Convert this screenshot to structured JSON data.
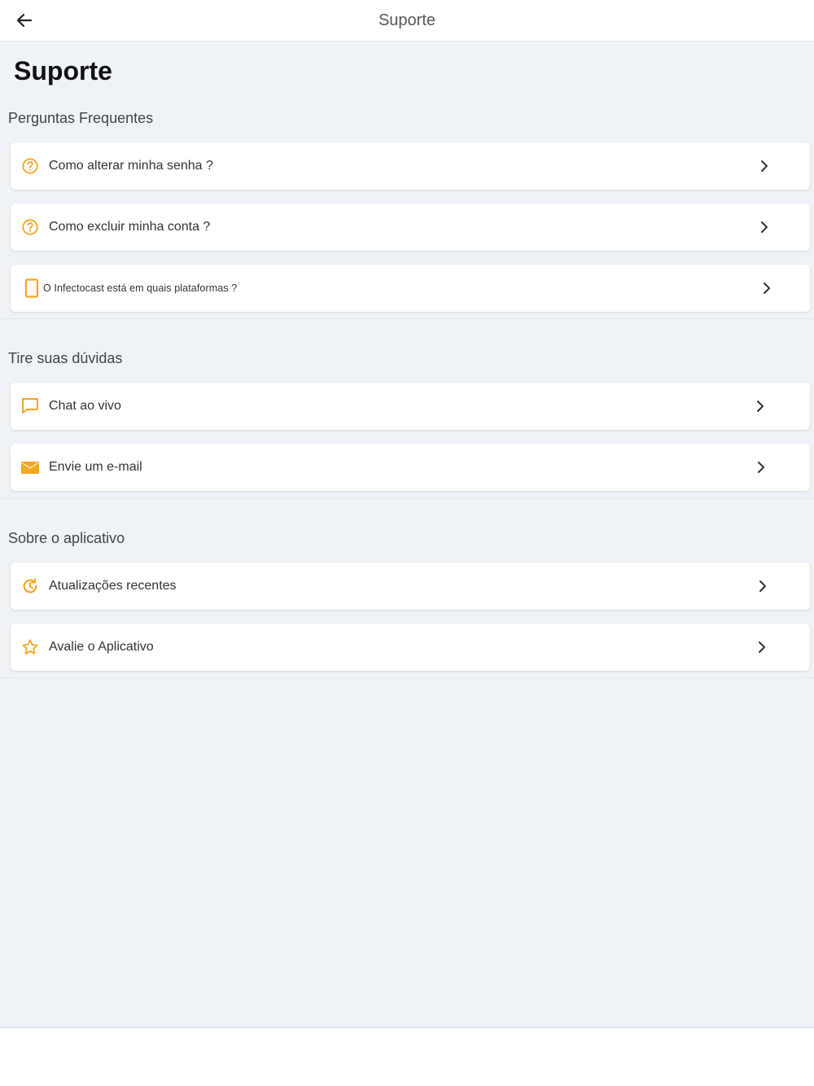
{
  "header": {
    "title": "Suporte"
  },
  "page": {
    "title": "Suporte"
  },
  "sections": [
    {
      "label": "Perguntas Frequentes",
      "items": [
        {
          "label": "Como alterar minha senha ?",
          "icon": "help-circle-icon"
        },
        {
          "label": "Como excluir minha conta ?",
          "icon": "help-circle-icon"
        },
        {
          "label": "O Infectocast está  em quais plataformas ?",
          "icon": "tablet-icon"
        }
      ]
    },
    {
      "label": "Tire suas dúvidas",
      "items": [
        {
          "label": "Chat ao vivo",
          "icon": "chat-bubble-icon"
        },
        {
          "label": "Envie um e-mail",
          "icon": "envelope-icon"
        }
      ]
    },
    {
      "label": "Sobre o aplicativo",
      "items": [
        {
          "label": "Atualizações recentes",
          "icon": "update-icon"
        },
        {
          "label": "Avalie o Aplicativo",
          "icon": "star-icon"
        }
      ]
    }
  ],
  "colors": {
    "accent": "#f5a623",
    "background": "#eff3f8",
    "card": "#ffffff"
  }
}
